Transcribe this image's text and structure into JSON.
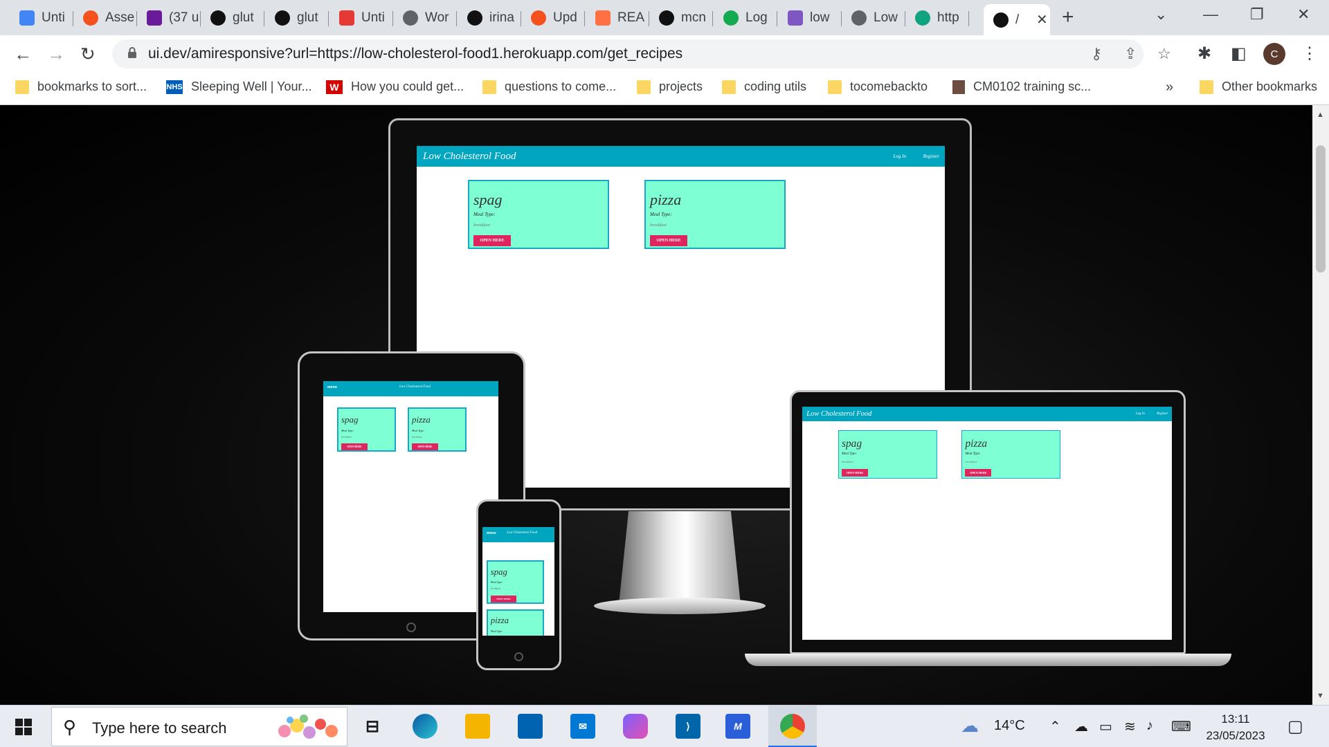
{
  "browser": {
    "tabs": [
      {
        "title": "Unti",
        "icon": "google-docs-icon",
        "color": "#4285f4"
      },
      {
        "title": "Asse",
        "icon": "red-circle-icon",
        "color": "#f4511e"
      },
      {
        "title": "(37 u",
        "icon": "mail-icon",
        "color": "#6a1b9a"
      },
      {
        "title": "glut",
        "icon": "github-icon",
        "color": "#111111"
      },
      {
        "title": "glut",
        "icon": "github-icon",
        "color": "#111111"
      },
      {
        "title": "Unti",
        "icon": "red-square-icon",
        "color": "#e53935"
      },
      {
        "title": "Wor",
        "icon": "globe-icon",
        "color": "#5f6368"
      },
      {
        "title": "irina",
        "icon": "github-icon",
        "color": "#111111"
      },
      {
        "title": "Upd",
        "icon": "red-circle-icon",
        "color": "#f4511e"
      },
      {
        "title": "REA",
        "icon": "orange-g-icon",
        "color": "#ff7043"
      },
      {
        "title": "mcn",
        "icon": "github-icon",
        "color": "#111111"
      },
      {
        "title": "Log",
        "icon": "mongodb-leaf-icon",
        "color": "#13aa52"
      },
      {
        "title": "low",
        "icon": "heroku-icon",
        "color": "#7e57c2"
      },
      {
        "title": "Low",
        "icon": "globe-icon",
        "color": "#5f6368"
      },
      {
        "title": "http",
        "icon": "chatgpt-icon",
        "color": "#10a37f"
      },
      {
        "title": "/",
        "icon": "uidev-icon",
        "color": "#111111"
      }
    ],
    "url": "ui.dev/amiresponsive?url=https://low-cholesterol-food1.herokuapp.com/get_recipes",
    "avatar_letter": "C",
    "bookmarks": [
      {
        "label": "bookmarks to sort...",
        "icon": "folder-icon"
      },
      {
        "label": "Sleeping Well | Your...",
        "icon": "nhs-icon",
        "badge": "NHS"
      },
      {
        "label": "How you could get...",
        "icon": "w-icon",
        "badge": "W"
      },
      {
        "label": "questions to come...",
        "icon": "folder-icon"
      },
      {
        "label": "projects",
        "icon": "folder-icon"
      },
      {
        "label": "coding utils",
        "icon": "folder-icon"
      },
      {
        "label": "tocomebackto",
        "icon": "folder-icon"
      },
      {
        "label": "CM0102 training sc...",
        "icon": "bookmark-page-icon"
      }
    ],
    "bookmarks_overflow": "»",
    "other_bookmarks": "Other bookmarks"
  },
  "site": {
    "brand": "Low Cholesterol Food",
    "brand_mobile": "Low Cholesterol Food",
    "menu": "menu",
    "login": "Log In",
    "register": "Register",
    "recipes": [
      {
        "title": "spag",
        "meta": "Meal Type:",
        "sub": "breakfast",
        "button": "OPEN HERE"
      },
      {
        "title": "pizza",
        "meta": "Meal Type:",
        "sub": "breakfast",
        "button": "OPEN HERE"
      }
    ]
  },
  "taskbar": {
    "search_placeholder": "Type here to search",
    "weather": "14°C",
    "time": "13:11",
    "date": "23/05/2023"
  }
}
